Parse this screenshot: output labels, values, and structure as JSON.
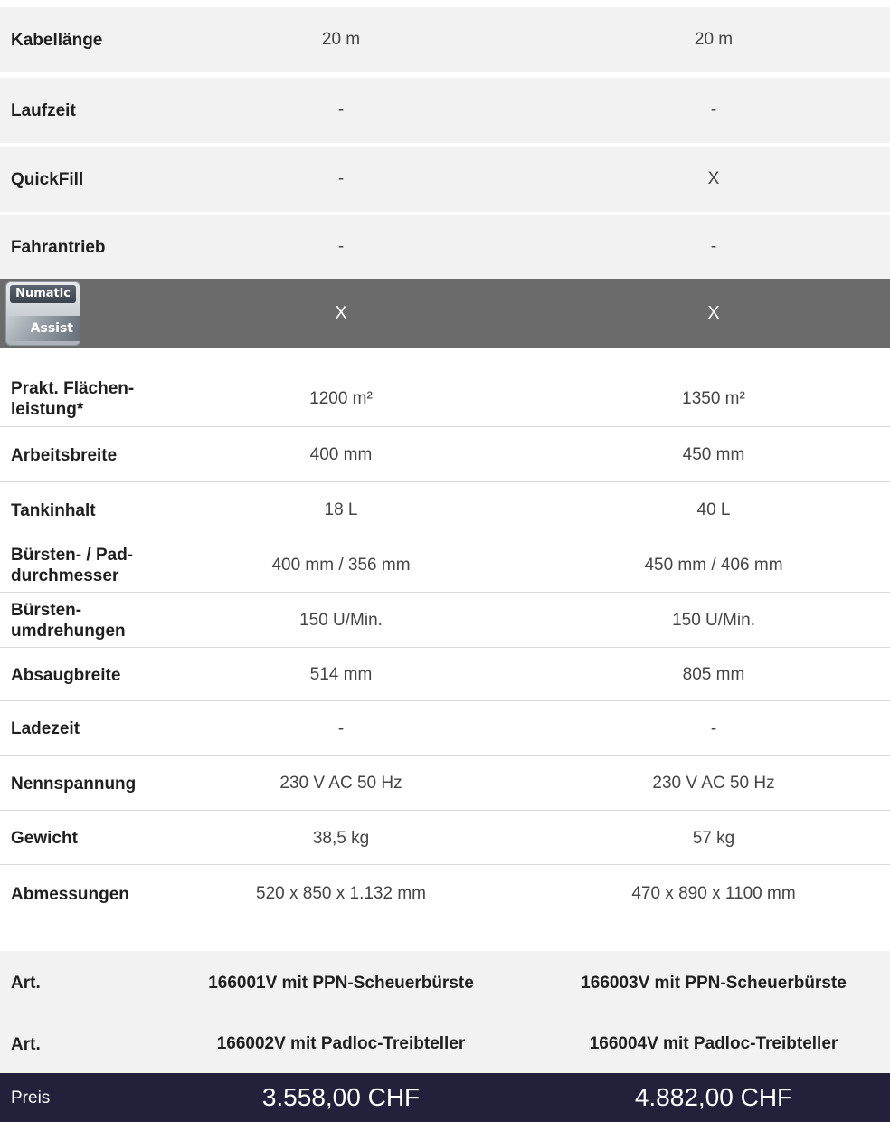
{
  "specs_top": [
    {
      "label": "Kabellänge",
      "v1": "20 m",
      "v2": "20 m"
    },
    {
      "label": "Laufzeit",
      "v1": "-",
      "v2": "-"
    },
    {
      "label": "QuickFill",
      "v1": "-",
      "v2": "X"
    },
    {
      "label": "Fahrantrieb",
      "v1": "-",
      "v2": "-"
    }
  ],
  "assist": {
    "logo_top": "Numatic",
    "logo_bottom": "Assist",
    "v1": "X",
    "v2": "X"
  },
  "specs": [
    {
      "label": "Prakt. Flächen-\nleistung*",
      "v1": "1200 m²",
      "v2": "1350 m²"
    },
    {
      "label": "Arbeitsbreite",
      "v1": "400 mm",
      "v2": "450 mm"
    },
    {
      "label": "Tankinhalt",
      "v1": "18 L",
      "v2": "40 L"
    },
    {
      "label": "Bürsten- / Pad-\ndurchmesser",
      "v1": "400 mm / 356 mm",
      "v2": "450 mm / 406 mm"
    },
    {
      "label": "Bürsten-\numdrehungen",
      "v1": "150 U/Min.",
      "v2": "150 U/Min."
    },
    {
      "label": "Absaugbreite",
      "v1": "514 mm",
      "v2": "805 mm"
    },
    {
      "label": "Ladezeit",
      "v1": "-",
      "v2": "-"
    },
    {
      "label": "Nennspannung",
      "v1": "230 V AC 50 Hz",
      "v2": "230 V AC 50 Hz"
    },
    {
      "label": "Gewicht",
      "v1": "38,5 kg",
      "v2": "57 kg"
    },
    {
      "label": "Abmessungen",
      "v1": "520 x 850 x 1.132 mm",
      "v2": "470 x 890 x 1100 mm"
    }
  ],
  "articles": [
    {
      "label": "Art.",
      "v1": "166001V mit PPN-Scheuerbürste",
      "v2": "166003V mit PPN-Scheuerbürste"
    },
    {
      "label": "Art.",
      "v1": "166002V mit Padloc-Treibteller",
      "v2": "166004V mit Padloc-Treibteller"
    }
  ],
  "price": {
    "label": "Preis",
    "v1": "3.558,00 CHF",
    "v2": "4.882,00 CHF"
  }
}
